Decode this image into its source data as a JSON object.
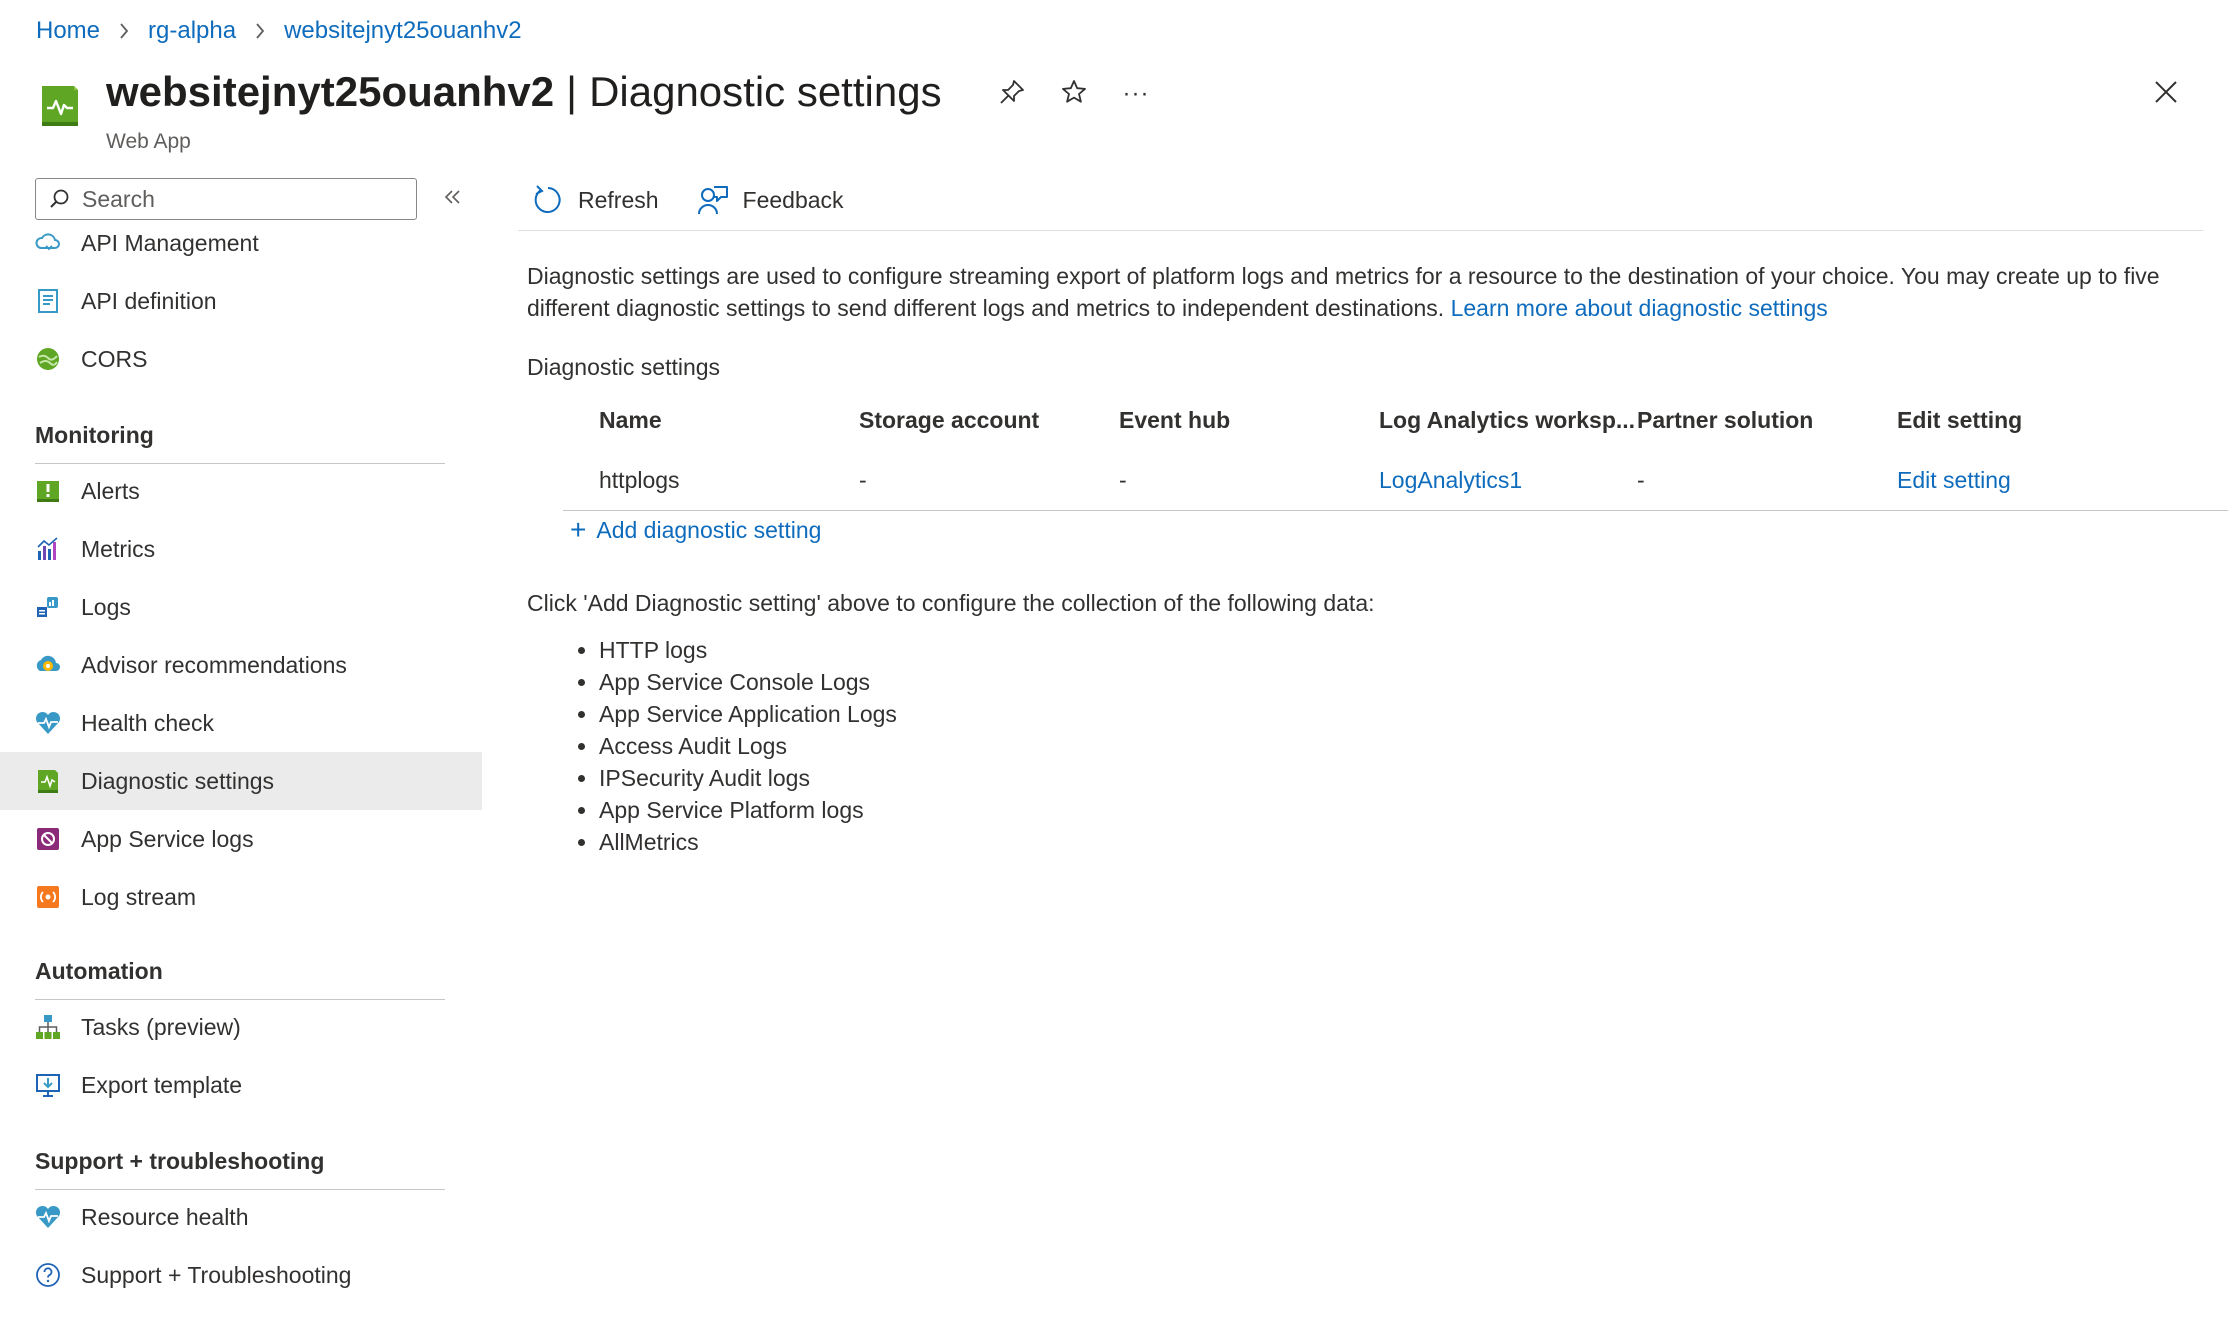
{
  "breadcrumb": {
    "items": [
      "Home",
      "rg-alpha",
      "websitejnyt25ouanhv2"
    ]
  },
  "header": {
    "resource_name": "websitejnyt25ouanhv2",
    "separator": "|",
    "page_name": "Diagnostic settings",
    "subtitle": "Web App",
    "more_label": "···"
  },
  "sidebar": {
    "search_placeholder": "Search",
    "items_top": [
      {
        "label": "API Management",
        "icon": "api-management-icon"
      },
      {
        "label": "API definition",
        "icon": "api-definition-icon"
      },
      {
        "label": "CORS",
        "icon": "cors-icon"
      }
    ],
    "sections": [
      {
        "title": "Monitoring",
        "items": [
          {
            "label": "Alerts",
            "icon": "alerts-icon"
          },
          {
            "label": "Metrics",
            "icon": "metrics-icon"
          },
          {
            "label": "Logs",
            "icon": "logs-icon"
          },
          {
            "label": "Advisor recommendations",
            "icon": "advisor-icon"
          },
          {
            "label": "Health check",
            "icon": "health-check-icon"
          },
          {
            "label": "Diagnostic settings",
            "icon": "diagnostic-settings-icon",
            "selected": true
          },
          {
            "label": "App Service logs",
            "icon": "app-service-logs-icon"
          },
          {
            "label": "Log stream",
            "icon": "log-stream-icon"
          }
        ]
      },
      {
        "title": "Automation",
        "items": [
          {
            "label": "Tasks (preview)",
            "icon": "tasks-icon"
          },
          {
            "label": "Export template",
            "icon": "export-template-icon"
          }
        ]
      },
      {
        "title": "Support + troubleshooting",
        "items": [
          {
            "label": "Resource health",
            "icon": "resource-health-icon"
          },
          {
            "label": "Support + Troubleshooting",
            "icon": "support-icon"
          }
        ]
      }
    ]
  },
  "toolbar": {
    "refresh_label": "Refresh",
    "feedback_label": "Feedback"
  },
  "main": {
    "description": "Diagnostic settings are used to configure streaming export of platform logs and metrics for a resource to the destination of your choice. You may create up to five different diagnostic settings to send different logs and metrics to independent destinations.",
    "learn_more": "Learn more about diagnostic settings",
    "section_label": "Diagnostic settings",
    "table": {
      "columns": [
        "Name",
        "Storage account",
        "Event hub",
        "Log Analytics worksp...",
        "Partner solution",
        "Edit setting"
      ],
      "rows": [
        {
          "name": "httplogs",
          "storage": "-",
          "event_hub": "-",
          "log_analytics": "LogAnalytics1",
          "partner": "-",
          "edit": "Edit setting"
        }
      ]
    },
    "add_label": "Add diagnostic setting",
    "add_plus": "+",
    "click_text": "Click 'Add Diagnostic setting' above to configure the collection of the following data:",
    "data_items": [
      "HTTP logs",
      "App Service Console Logs",
      "App Service Application Logs",
      "Access Audit Logs",
      "IPSecurity Audit logs",
      "App Service Platform logs",
      "AllMetrics"
    ]
  },
  "colors": {
    "link": "#0f6cbd",
    "selected_bg": "#ebebeb",
    "web_app_green": "#5ea624"
  }
}
